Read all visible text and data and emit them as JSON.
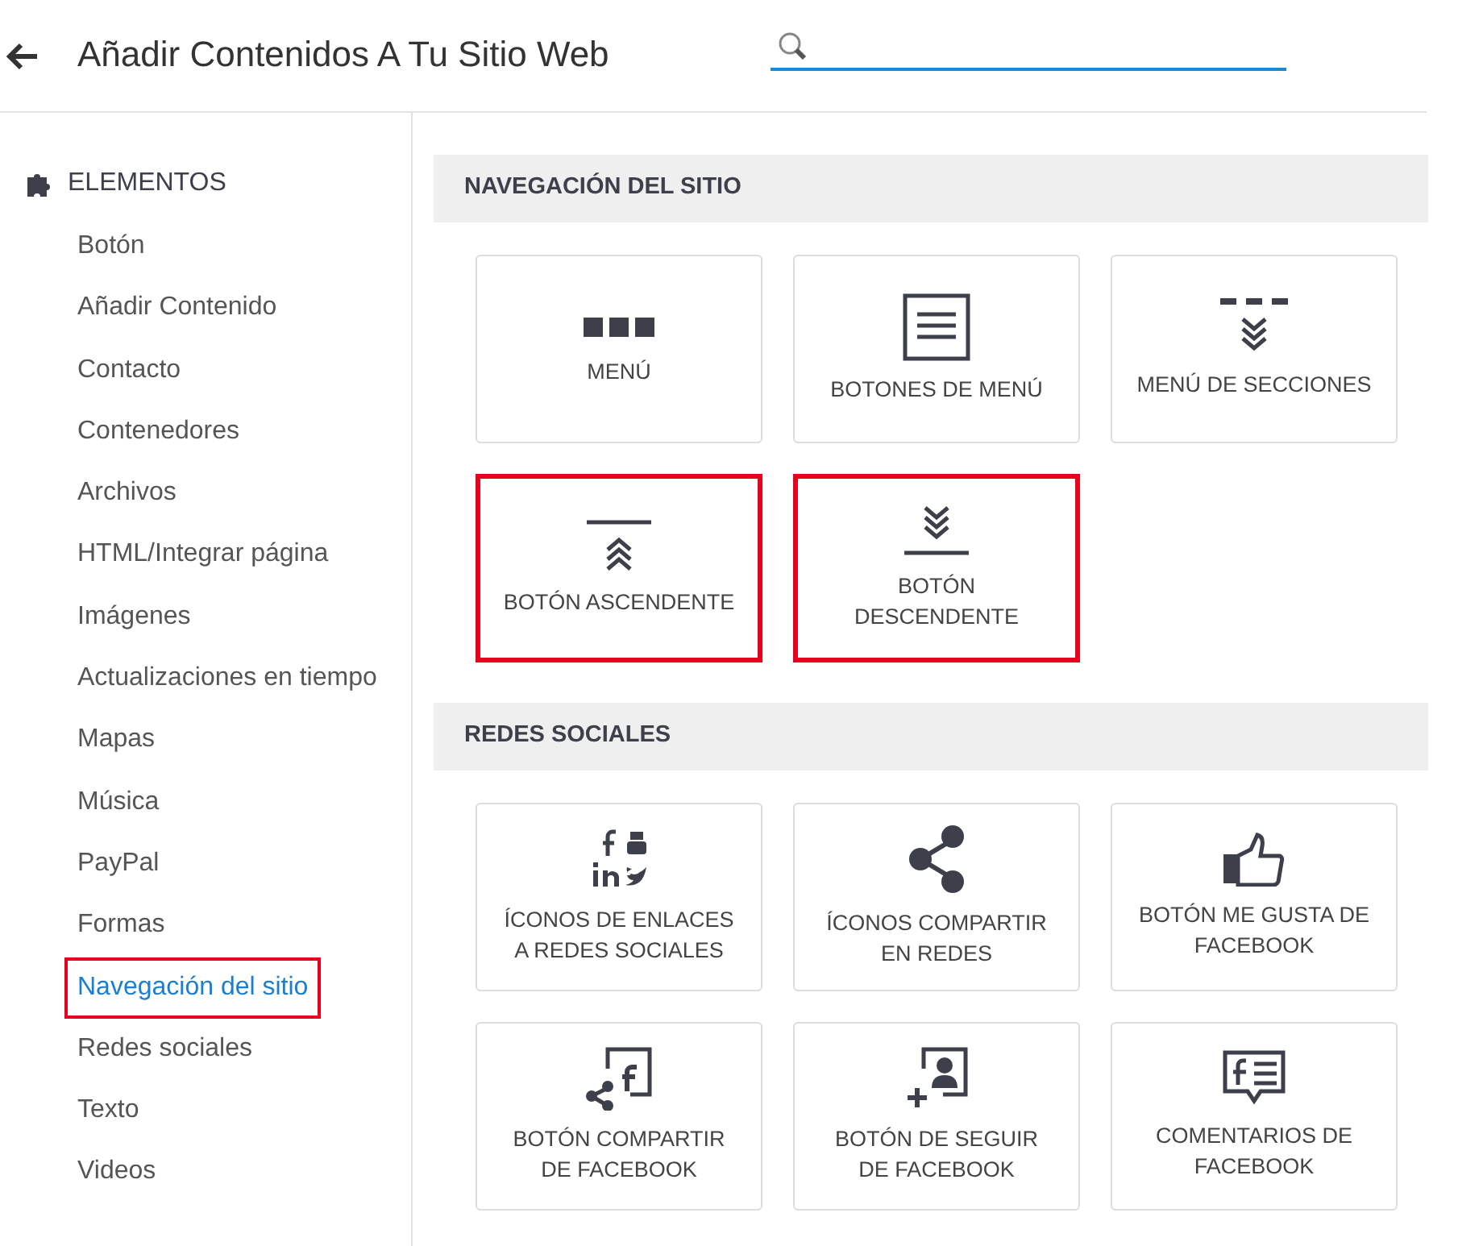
{
  "header": {
    "title": "Añadir Contenidos A Tu Sitio Web"
  },
  "sidebar": {
    "heading": "ELEMENTOS",
    "items": [
      {
        "label": "Botón",
        "selected": false,
        "highlighted": false
      },
      {
        "label": "Añadir Contenido",
        "selected": false,
        "highlighted": false
      },
      {
        "label": "Contacto",
        "selected": false,
        "highlighted": false
      },
      {
        "label": "Contenedores",
        "selected": false,
        "highlighted": false
      },
      {
        "label": "Archivos",
        "selected": false,
        "highlighted": false
      },
      {
        "label": "HTML/Integrar página",
        "selected": false,
        "highlighted": false
      },
      {
        "label": "Imágenes",
        "selected": false,
        "highlighted": false
      },
      {
        "label": "Actualizaciones en tiempo",
        "selected": false,
        "highlighted": false
      },
      {
        "label": "Mapas",
        "selected": false,
        "highlighted": false
      },
      {
        "label": "Música",
        "selected": false,
        "highlighted": false
      },
      {
        "label": "PayPal",
        "selected": false,
        "highlighted": false
      },
      {
        "label": "Formas",
        "selected": false,
        "highlighted": false
      },
      {
        "label": "Navegación del sitio",
        "selected": true,
        "highlighted": true
      },
      {
        "label": "Redes sociales",
        "selected": false,
        "highlighted": false
      },
      {
        "label": "Texto",
        "selected": false,
        "highlighted": false
      },
      {
        "label": "Videos",
        "selected": false,
        "highlighted": false
      }
    ]
  },
  "sections": [
    {
      "title": "NAVEGACIÓN DEL SITIO",
      "tiles": [
        {
          "kind": "menu",
          "label": "MENÚ",
          "highlighted": false
        },
        {
          "kind": "menu-buttons",
          "label": "BOTONES DE MENÚ",
          "highlighted": false
        },
        {
          "kind": "sections",
          "label": "MENÚ DE SECCIONES",
          "highlighted": false
        },
        {
          "kind": "up",
          "label": "BOTÓN ASCENDENTE",
          "highlighted": true
        },
        {
          "kind": "down",
          "label": "BOTÓN DESCENDENTE",
          "highlighted": true
        }
      ]
    },
    {
      "title": "REDES SOCIALES",
      "tiles": [
        {
          "kind": "social",
          "label": "ÍCONOS DE ENLACES A REDES SOCIALES",
          "highlighted": false
        },
        {
          "kind": "share",
          "label": "ÍCONOS COMPARTIR EN REDES",
          "highlighted": false
        },
        {
          "kind": "like",
          "label": "BOTÓN ME GUSTA DE FACEBOOK",
          "highlighted": false
        },
        {
          "kind": "fb-share",
          "label": "BOTÓN COMPARTIR DE FACEBOOK",
          "highlighted": false
        },
        {
          "kind": "follow",
          "label": "BOTÓN DE SEGUIR DE FACEBOOK",
          "highlighted": false
        },
        {
          "kind": "comments",
          "label": "COMENTARIOS DE FACEBOOK",
          "highlighted": false
        }
      ]
    }
  ]
}
